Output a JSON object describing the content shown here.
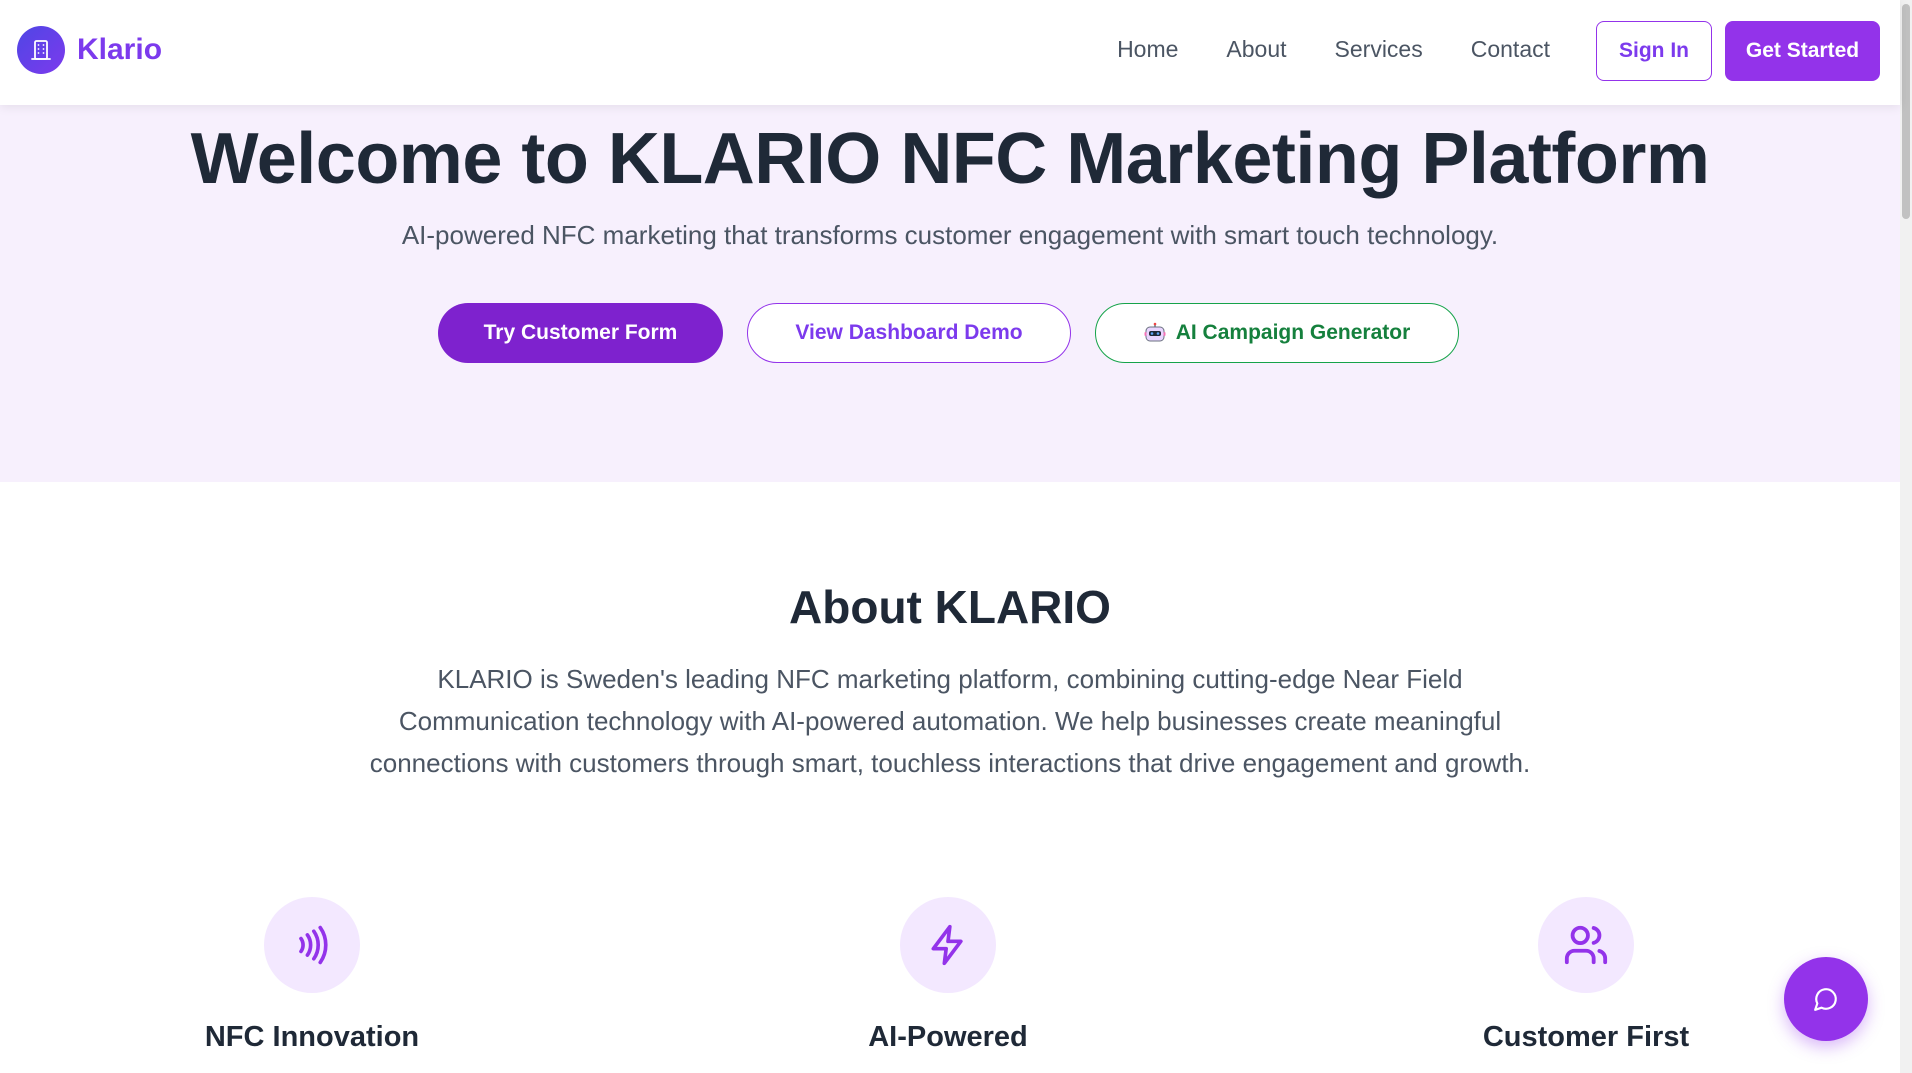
{
  "header": {
    "logo_text": "Klario",
    "nav": [
      {
        "label": "Home"
      },
      {
        "label": "About"
      },
      {
        "label": "Services"
      },
      {
        "label": "Contact"
      }
    ],
    "sign_in_label": "Sign In",
    "get_started_label": "Get Started"
  },
  "hero": {
    "title": "Welcome to KLARIO NFC Marketing Platform",
    "subtitle": "AI-powered NFC marketing that transforms customer engagement with smart touch technology.",
    "buttons": {
      "customer_form": "Try Customer Form",
      "dashboard_demo": "View Dashboard Demo",
      "ai_campaign": "AI Campaign Generator"
    }
  },
  "about": {
    "title": "About KLARIO",
    "text": "KLARIO is Sweden's leading NFC marketing platform, combining cutting-edge Near Field Communication technology with AI-powered automation. We help businesses create meaningful connections with customers through smart, touchless interactions that drive engagement and growth.",
    "features": [
      {
        "title": "NFC Innovation",
        "icon": "nfc-waves-icon"
      },
      {
        "title": "AI-Powered",
        "icon": "lightning-icon"
      },
      {
        "title": "Customer First",
        "icon": "users-icon"
      }
    ]
  },
  "colors": {
    "brand": "#9333ea",
    "hero_bg": "#f7f0fd",
    "ai_green": "#16a34a",
    "text_dark": "#1f2937",
    "text_muted": "#4b5563"
  }
}
